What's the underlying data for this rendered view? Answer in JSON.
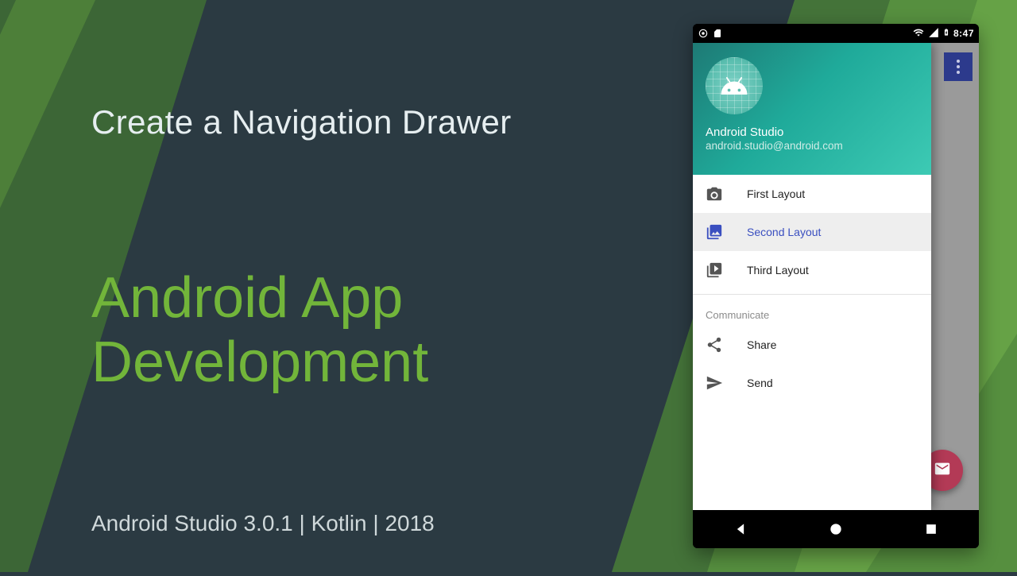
{
  "slide": {
    "title": "Create a Navigation Drawer",
    "big_line1": "Android App",
    "big_line2": "Development",
    "footer": "Android Studio 3.0.1 | Kotlin | 2018"
  },
  "phone": {
    "status": {
      "time": "8:47"
    },
    "drawer": {
      "header": {
        "name": "Android Studio",
        "email": "android.studio@android.com"
      },
      "items": [
        {
          "icon": "camera-icon",
          "label": "First Layout",
          "selected": false
        },
        {
          "icon": "gallery-icon",
          "label": "Second Layout",
          "selected": true
        },
        {
          "icon": "slideshow-icon",
          "label": "Third Layout",
          "selected": false
        }
      ],
      "section_label": "Communicate",
      "communicate": [
        {
          "icon": "share-icon",
          "label": "Share"
        },
        {
          "icon": "send-icon",
          "label": "Send"
        }
      ]
    }
  },
  "colors": {
    "accent": "#72b53a",
    "drawer_selected": "#3a4fc0",
    "fab": "#b33a56"
  }
}
